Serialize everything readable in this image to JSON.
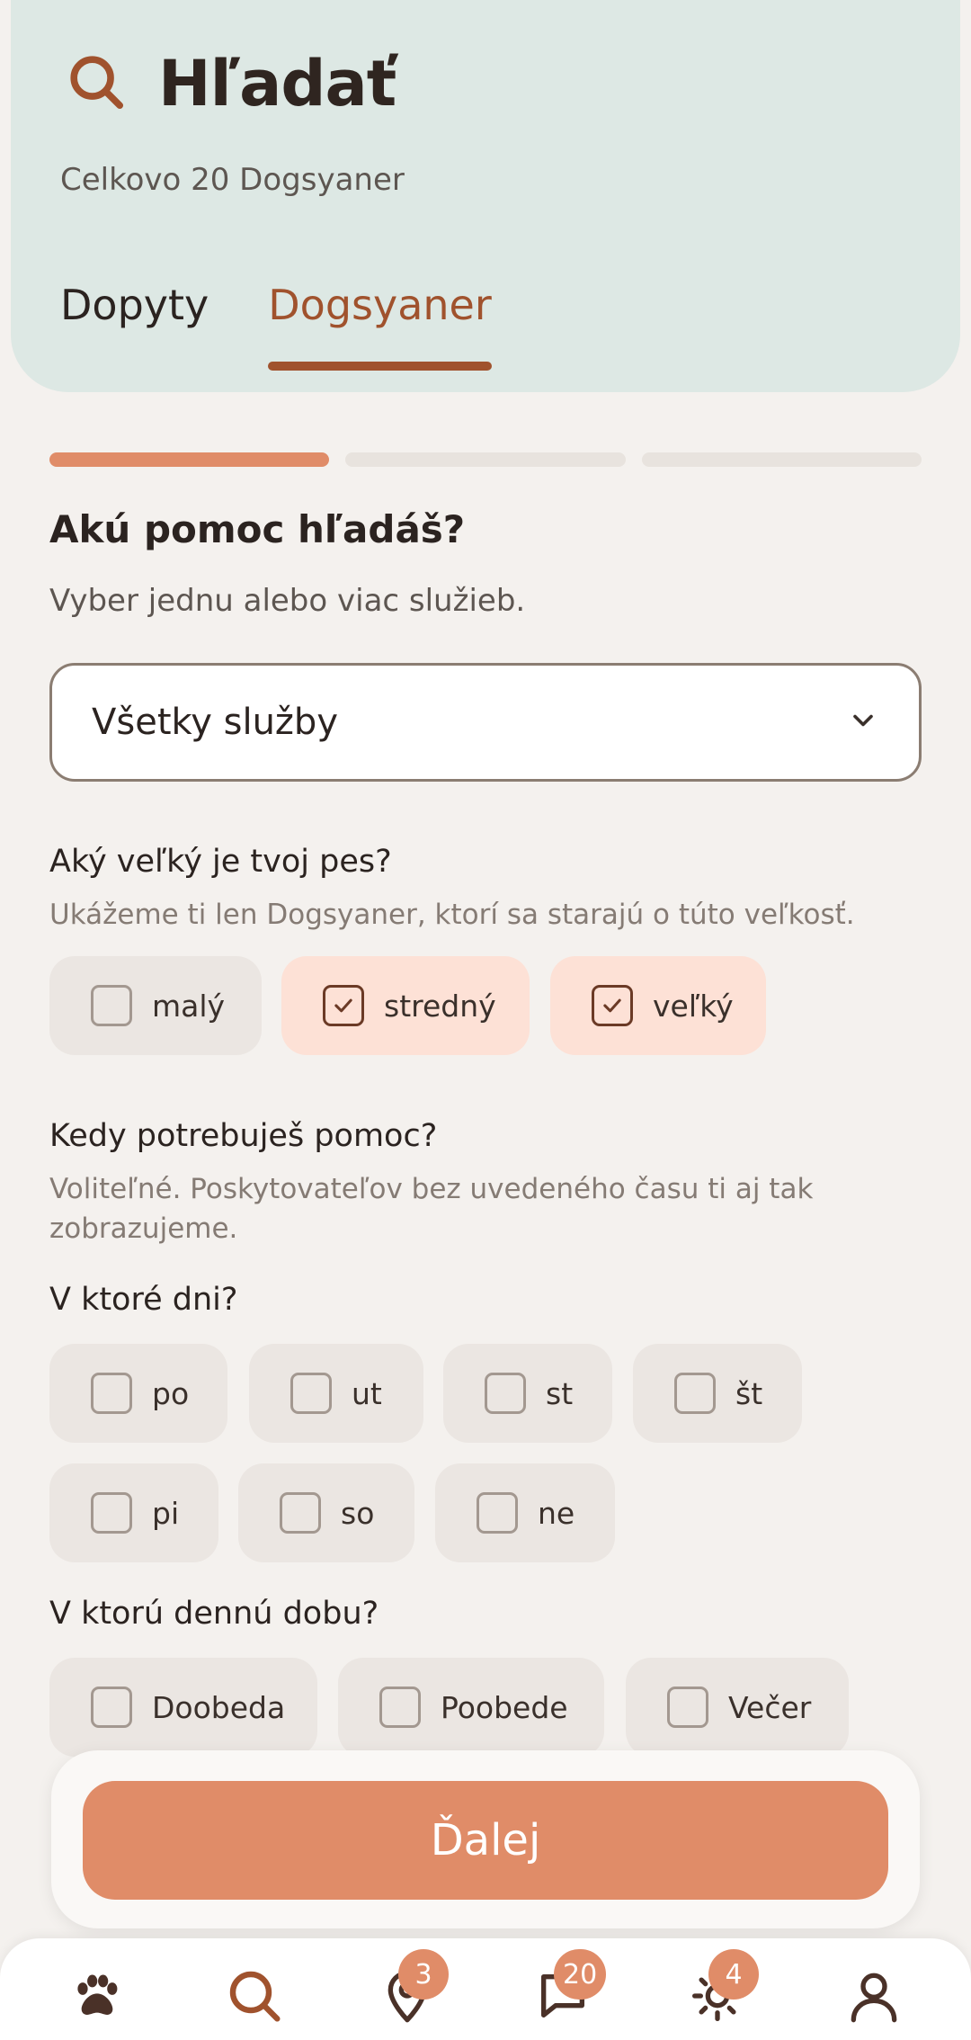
{
  "header": {
    "title": "Hľadať",
    "subtitle": "Celkovo 20 Dogsyaner",
    "tabs": [
      {
        "label": "Dopyty",
        "active": false
      },
      {
        "label": "Dogsyaner",
        "active": true
      }
    ]
  },
  "progress": {
    "step": 1,
    "total": 3
  },
  "question": {
    "title": "Akú pomoc hľadáš?",
    "subtitle": "Vyber jednu alebo viac služieb."
  },
  "service_select": {
    "value": "Všetky služby"
  },
  "dog_size": {
    "label": "Aký veľký je tvoj pes?",
    "hint": "Ukážeme ti len Dogsyaner, ktorí sa starajú o túto veľkosť.",
    "options": [
      {
        "label": "malý",
        "checked": false
      },
      {
        "label": "stredný",
        "checked": true
      },
      {
        "label": "veľký",
        "checked": true
      }
    ]
  },
  "when": {
    "label": "Kedy potrebuješ pomoc?",
    "hint": "Voliteľné. Poskytovateľov bez uvedeného času ti aj tak zobrazujeme."
  },
  "days": {
    "label": "V ktoré dni?",
    "options": [
      {
        "label": "po",
        "checked": false
      },
      {
        "label": "ut",
        "checked": false
      },
      {
        "label": "st",
        "checked": false
      },
      {
        "label": "št",
        "checked": false
      },
      {
        "label": "pi",
        "checked": false
      },
      {
        "label": "so",
        "checked": false
      },
      {
        "label": "ne",
        "checked": false
      }
    ]
  },
  "time_of_day": {
    "label": "V ktorú dennú dobu?",
    "options": [
      {
        "label": "Doobeda",
        "checked": false
      },
      {
        "label": "Poobede",
        "checked": false
      },
      {
        "label": "Večer",
        "checked": false
      }
    ]
  },
  "next_button": {
    "label": "Ďalej"
  },
  "bottom_nav": {
    "items": [
      {
        "icon": "paw-icon",
        "badge": ""
      },
      {
        "icon": "search-icon",
        "badge": ""
      },
      {
        "icon": "map-pin-icon",
        "badge": "3"
      },
      {
        "icon": "chat-icon",
        "badge": "20"
      },
      {
        "icon": "sun-icon",
        "badge": "4"
      },
      {
        "icon": "profile-icon",
        "badge": ""
      }
    ]
  },
  "colors": {
    "accent": "#a0522d",
    "button": "#e08c68",
    "header_bg": "#dde8e4",
    "chip_selected": "#fde1d6",
    "chip_default": "#ebe6e2"
  }
}
